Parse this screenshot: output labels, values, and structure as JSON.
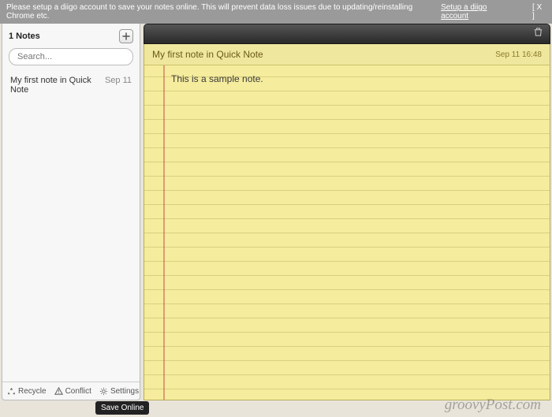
{
  "banner": {
    "text": "Please setup a diigo account to save your notes online. This will prevent data loss issues due to updating/reinstalling Chrome etc.",
    "link": "Setup a diigo account",
    "close": "[ X ]"
  },
  "sidebar": {
    "count_label": "1 Notes",
    "search_placeholder": "Search...",
    "items": [
      {
        "title": "My first note in Quick Note",
        "date": "Sep 11"
      }
    ],
    "footer": {
      "recycle": "Recycle",
      "conflict": "Conflict",
      "settings": "Settings"
    },
    "tooltip": "Save Online"
  },
  "editor": {
    "title": "My first note in Quick Note",
    "timestamp": "Sep 11 16:48",
    "body": "This is a sample note."
  },
  "watermark": "groovyPost.com"
}
